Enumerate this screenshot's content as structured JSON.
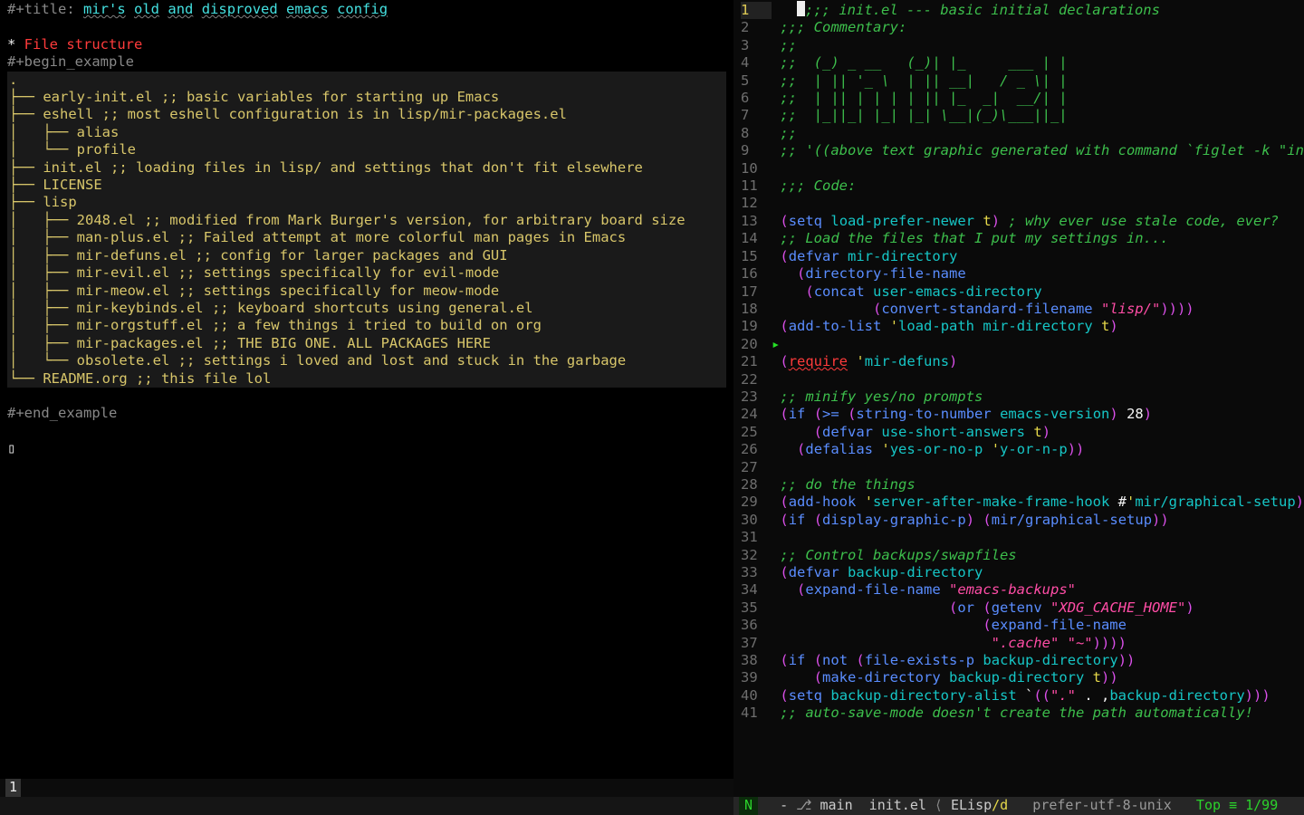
{
  "left": {
    "title_prefix": "#+title: ",
    "title_words": [
      "mir's",
      "old",
      "and",
      "disproved",
      "emacs",
      "config"
    ],
    "heading_star": "* ",
    "heading": "File structure",
    "begin": "#+begin_example",
    "end": "#+end_example",
    "tree": [
      ".",
      "├── early-init.el ;; basic variables for starting up Emacs",
      "├── eshell ;; most eshell configuration is in lisp/mir-packages.el",
      "│   ├── alias",
      "│   └── profile",
      "├── init.el ;; loading files in lisp/ and settings that don't fit elsewhere",
      "├── LICENSE",
      "├── lisp",
      "│   ├── 2048.el ;; modified from Mark Burger's version, for arbitrary board size",
      "│   ├── man-plus.el ;; Failed attempt at more colorful man pages in Emacs",
      "│   ├── mir-defuns.el ;; config for larger packages and GUI",
      "│   ├── mir-evil.el ;; settings specifically for evil-mode",
      "│   ├── mir-meow.el ;; settings specifically for meow-mode",
      "│   ├── mir-keybinds.el ;; keyboard shortcuts using general.el",
      "│   ├── mir-orgstuff.el ;; a few things i tried to build on org",
      "│   ├── mir-packages.el ;; THE BIG ONE. ALL PACKAGES HERE",
      "│   └── obsolete.el ;; settings i loved and lost and stuck in the garbage",
      "└── README.org ;; this file lol"
    ],
    "cursor_placeholder": "▯",
    "tabs": {
      "active": "1"
    }
  },
  "right": {
    "line_start": 1,
    "lines": [
      [
        [
          "cg",
          ";;; init.el --- basic initial declarations"
        ]
      ],
      [
        [
          "cg",
          ";;; Commentary:"
        ]
      ],
      [
        [
          "cg",
          ";;"
        ]
      ],
      [
        [
          "cg",
          ";;  (_) _ __   (_)| |_     ___ | |"
        ]
      ],
      [
        [
          "cg",
          ";;  | || '_ \\  | || __|   / _ \\| |"
        ]
      ],
      [
        [
          "cg",
          ";;  | || | | | | || |_  _|  __/| |"
        ]
      ],
      [
        [
          "cg",
          ";;  |_||_| |_| |_| \\__|(_)\\___||_|"
        ]
      ],
      [
        [
          "cg",
          ";;"
        ]
      ],
      [
        [
          "cg",
          ";; '((above text graphic generated with command `figlet -k \"init.el\"'))"
        ]
      ],
      [],
      [
        [
          "cg",
          ";;; Code:"
        ]
      ],
      [],
      [
        [
          "pr",
          "("
        ],
        [
          "fn",
          "setq"
        ],
        [
          "",
          " "
        ],
        [
          "vn",
          "load-prefer-newer"
        ],
        [
          "",
          " "
        ],
        [
          "yl",
          "t"
        ],
        [
          "pr",
          ")"
        ],
        [
          "",
          " "
        ],
        [
          "cg",
          "; why ever use stale code, ever?"
        ]
      ],
      [
        [
          "cg",
          ";; Load the files that I put my settings in..."
        ]
      ],
      [
        [
          "pr",
          "("
        ],
        [
          "fn",
          "defvar"
        ],
        [
          "",
          " "
        ],
        [
          "vn",
          "mir-directory"
        ]
      ],
      [
        [
          "",
          "  "
        ],
        [
          "pr",
          "("
        ],
        [
          "fn",
          "directory-file-name"
        ]
      ],
      [
        [
          "",
          "   "
        ],
        [
          "pr",
          "("
        ],
        [
          "fn",
          "concat"
        ],
        [
          "",
          " "
        ],
        [
          "vn",
          "user-emacs-directory"
        ]
      ],
      [
        [
          "",
          "           "
        ],
        [
          "pr",
          "("
        ],
        [
          "fn",
          "convert-standard-filename"
        ],
        [
          "",
          " "
        ],
        [
          "str",
          "\"lisp/\""
        ],
        [
          "pr",
          "))))"
        ]
      ],
      [
        [
          "pr",
          "("
        ],
        [
          "fn",
          "add-to-list"
        ],
        [
          "",
          " "
        ],
        [
          "yl",
          "'"
        ],
        [
          "vn",
          "load-path"
        ],
        [
          "",
          " "
        ],
        [
          "vn",
          "mir-directory"
        ],
        [
          "",
          " "
        ],
        [
          "yl",
          "t"
        ],
        [
          "pr",
          ")"
        ]
      ],
      [],
      [
        [
          "pr",
          "("
        ],
        [
          "rl",
          "require"
        ],
        [
          "",
          " "
        ],
        [
          "yl",
          "'"
        ],
        [
          "vn",
          "mir-defuns"
        ],
        [
          "pr",
          ")"
        ]
      ],
      [],
      [
        [
          "cg",
          ";; minify yes/no prompts"
        ]
      ],
      [
        [
          "pr",
          "("
        ],
        [
          "fn",
          "if"
        ],
        [
          "",
          " "
        ],
        [
          "pr",
          "("
        ],
        [
          "fn",
          ">="
        ],
        [
          "",
          " "
        ],
        [
          "pr",
          "("
        ],
        [
          "fn",
          "string-to-number"
        ],
        [
          "",
          " "
        ],
        [
          "vn",
          "emacs-version"
        ],
        [
          "pr",
          ")"
        ],
        [
          "",
          " "
        ],
        [
          "num",
          "28"
        ],
        [
          "pr",
          ")"
        ]
      ],
      [
        [
          "",
          "    "
        ],
        [
          "pr",
          "("
        ],
        [
          "fn",
          "defvar"
        ],
        [
          "",
          " "
        ],
        [
          "vn",
          "use-short-answers"
        ],
        [
          "",
          " "
        ],
        [
          "yl",
          "t"
        ],
        [
          "pr",
          ")"
        ]
      ],
      [
        [
          "",
          "  "
        ],
        [
          "pr",
          "("
        ],
        [
          "fn",
          "defalias"
        ],
        [
          "",
          " "
        ],
        [
          "yl",
          "'"
        ],
        [
          "vn",
          "yes-or-no-p"
        ],
        [
          "",
          " "
        ],
        [
          "yl",
          "'"
        ],
        [
          "vn",
          "y-or-n-p"
        ],
        [
          "pr",
          "))"
        ]
      ],
      [],
      [
        [
          "cg",
          ";; do the things"
        ]
      ],
      [
        [
          "pr",
          "("
        ],
        [
          "fn",
          "add-hook"
        ],
        [
          "",
          " "
        ],
        [
          "yl",
          "'"
        ],
        [
          "vn",
          "server-after-make-frame-hook"
        ],
        [
          "",
          " #"
        ],
        [
          "yl",
          "'"
        ],
        [
          "vn",
          "mir/graphical-setup"
        ],
        [
          "pr",
          ")"
        ]
      ],
      [
        [
          "pr",
          "("
        ],
        [
          "fn",
          "if"
        ],
        [
          "",
          " "
        ],
        [
          "pr",
          "("
        ],
        [
          "fn",
          "display-graphic-p"
        ],
        [
          "pr",
          ")"
        ],
        [
          "",
          " "
        ],
        [
          "pr",
          "("
        ],
        [
          "fn",
          "mir/graphical-setup"
        ],
        [
          "pr",
          "))"
        ]
      ],
      [],
      [
        [
          "cg",
          ";; Control backups/swapfiles"
        ]
      ],
      [
        [
          "pr",
          "("
        ],
        [
          "fn",
          "defvar"
        ],
        [
          "",
          " "
        ],
        [
          "vn",
          "backup-directory"
        ]
      ],
      [
        [
          "",
          "  "
        ],
        [
          "pr",
          "("
        ],
        [
          "fn",
          "expand-file-name"
        ],
        [
          "",
          " "
        ],
        [
          "str",
          "\"emacs-backups\""
        ]
      ],
      [
        [
          "",
          "                    "
        ],
        [
          "pr",
          "("
        ],
        [
          "fn",
          "or"
        ],
        [
          "",
          " "
        ],
        [
          "pr",
          "("
        ],
        [
          "fn",
          "getenv"
        ],
        [
          "",
          " "
        ],
        [
          "str",
          "\"XDG_CACHE_HOME\""
        ],
        [
          "pr",
          ")"
        ]
      ],
      [
        [
          "",
          "                        "
        ],
        [
          "pr",
          "("
        ],
        [
          "fn",
          "expand-file-name"
        ]
      ],
      [
        [
          "",
          "                         "
        ],
        [
          "str",
          "\".cache\""
        ],
        [
          "",
          " "
        ],
        [
          "str",
          "\"~\""
        ],
        [
          "pr",
          ")))) "
        ]
      ],
      [
        [
          "pr",
          "("
        ],
        [
          "fn",
          "if"
        ],
        [
          "",
          " "
        ],
        [
          "pr",
          "("
        ],
        [
          "fn",
          "not"
        ],
        [
          "",
          " "
        ],
        [
          "pr",
          "("
        ],
        [
          "fn",
          "file-exists-p"
        ],
        [
          "",
          " "
        ],
        [
          "vn",
          "backup-directory"
        ],
        [
          "pr",
          "))"
        ]
      ],
      [
        [
          "",
          "    "
        ],
        [
          "pr",
          "("
        ],
        [
          "fn",
          "make-directory"
        ],
        [
          "",
          " "
        ],
        [
          "vn",
          "backup-directory"
        ],
        [
          "",
          " "
        ],
        [
          "yl",
          "t"
        ],
        [
          "pr",
          "))"
        ]
      ],
      [
        [
          "pr",
          "("
        ],
        [
          "fn",
          "setq"
        ],
        [
          "",
          " "
        ],
        [
          "vn",
          "backup-directory-alist"
        ],
        [
          "",
          " `"
        ],
        [
          "pr",
          "(("
        ],
        [
          "str",
          "\".\""
        ],
        [
          "",
          " . ,"
        ],
        [
          "vn",
          "backup-directory"
        ],
        [
          "pr",
          ")))"
        ]
      ],
      [
        [
          "cg",
          ";; auto-save-mode doesn't create the path automatically!"
        ]
      ]
    ],
    "special_line": 20,
    "modeline": {
      "state": "N",
      "left": "  - ",
      "branch_icon": "⎇",
      "branch": " main",
      "file": "  init.el",
      "sep": " ⟨ ",
      "mode1": "ELisp",
      "sep2": "/",
      "mode2": "d",
      "encoding": "   prefer-utf-8-unix",
      "pos": "   Top ≡ 1/99"
    }
  }
}
